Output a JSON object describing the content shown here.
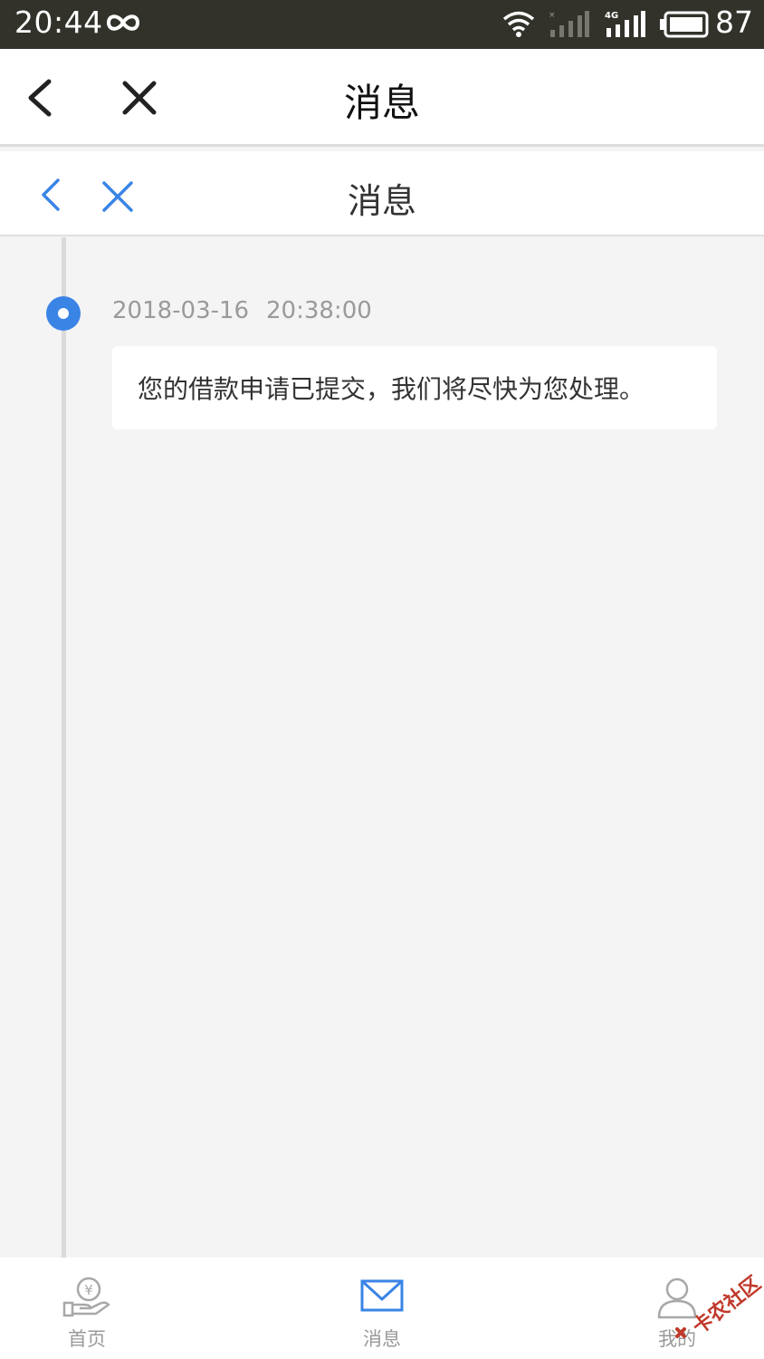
{
  "status_bar": {
    "time": "20:44",
    "battery": "87"
  },
  "nav_outer": {
    "title": "消息"
  },
  "nav_inner": {
    "title": "消息"
  },
  "message": {
    "date": "2018-03-16",
    "time": "20:38:00",
    "text": "您的借款申请已提交，我们将尽快为您处理。"
  },
  "tabs": [
    {
      "label": "首页",
      "icon": "home-yuan-hand-icon"
    },
    {
      "label": "消息",
      "icon": "envelope-icon",
      "active": true
    },
    {
      "label": "我的",
      "icon": "user-icon"
    }
  ],
  "colors": {
    "accent": "#3a84e6",
    "status_bar": "#32322b",
    "background": "#f4f4f5"
  },
  "watermark": {
    "text": "卡农社区"
  }
}
